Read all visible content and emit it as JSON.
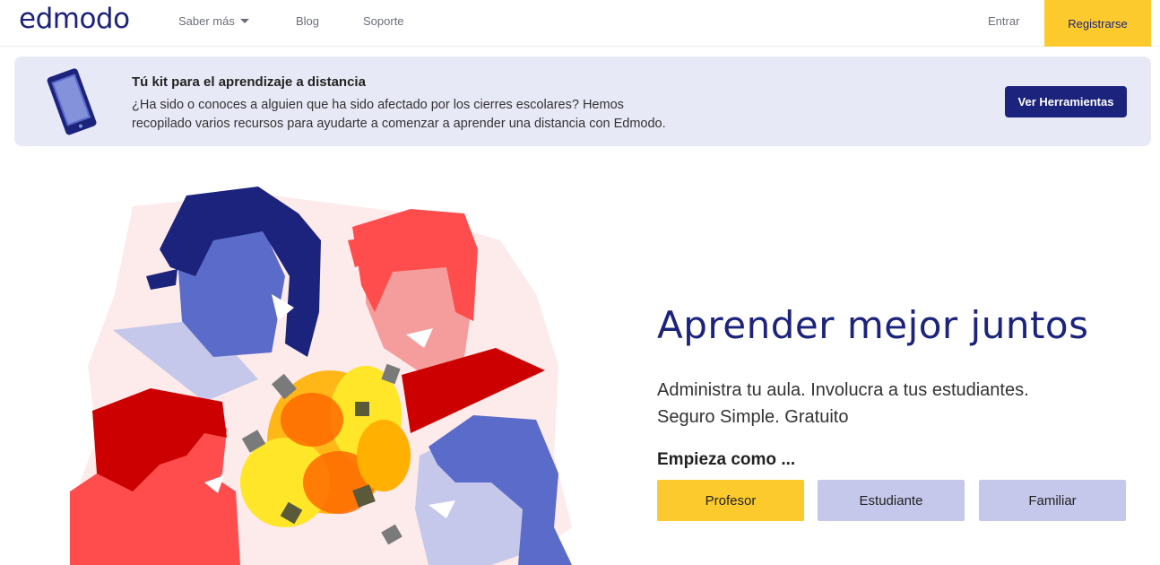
{
  "nav": {
    "logo": "edmodo",
    "saber_mas": "Saber más",
    "blog": "Blog",
    "soporte": "Soporte",
    "entrar": "Entrar",
    "registrarse": "Registrarse"
  },
  "banner": {
    "icon": "tablet-icon",
    "title": "Tú kit para el aprendizaje a distancia",
    "text_line1": "¿Ha sido o conoces a alguien que ha sido afectado por los cierres escolares? Hemos",
    "text_line2": "recopilado varios recursos para ayudarte a comenzar a aprender una distancia con Edmodo.",
    "button": "Ver Herramientas"
  },
  "hero": {
    "title": "Aprender mejor juntos",
    "subtitle_line1": "Administra tu aula. Involucra a tus estudiantes.",
    "subtitle_line2": "Seguro Simple. Gratuito",
    "start_label": "Empieza como ...",
    "roles": [
      "Profesor",
      "Estudiante",
      "Familiar"
    ]
  },
  "colors": {
    "brand": "#1c237c",
    "accent_yellow": "#fdca2e",
    "banner_bg": "#e8e9f6",
    "role_secondary": "#c5c8ea"
  }
}
